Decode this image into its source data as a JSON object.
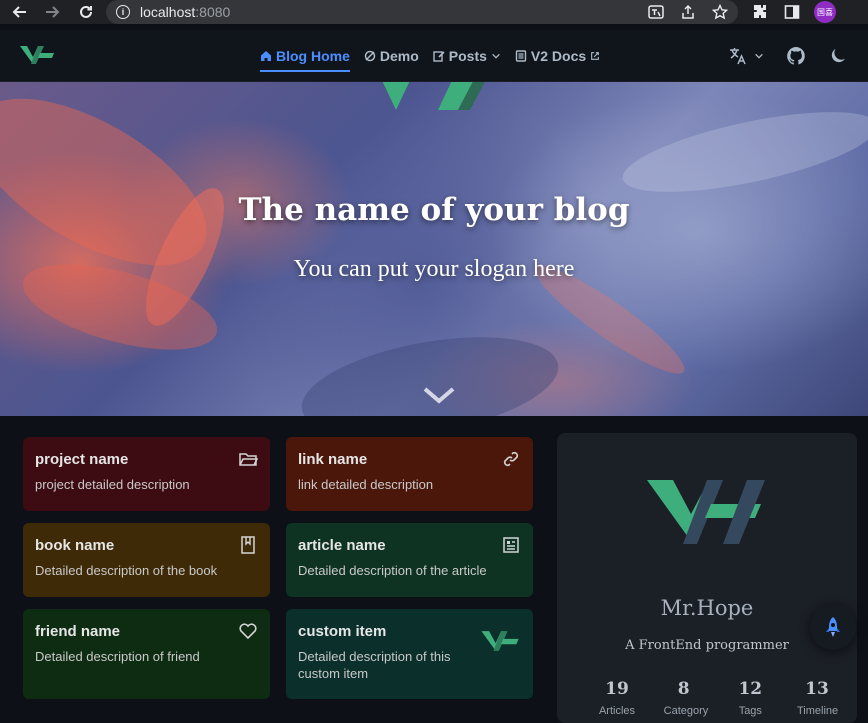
{
  "browser": {
    "url_host": "localhost",
    "url_port": ":8080",
    "profile_label": "国喜"
  },
  "navbar": {
    "items": [
      {
        "label": "Blog Home",
        "icon": "home-icon",
        "active": true
      },
      {
        "label": "Demo",
        "icon": "demo-icon",
        "active": false
      },
      {
        "label": "Posts",
        "icon": "edit-icon",
        "active": false
      },
      {
        "label": "V2 Docs",
        "icon": "docs-icon",
        "active": false
      }
    ]
  },
  "hero": {
    "title": "The name of your blog",
    "slogan": "You can put your slogan here"
  },
  "projects": [
    {
      "title": "project name",
      "desc": "project detailed description",
      "icon": "folder-icon",
      "color": "#3d0b12"
    },
    {
      "title": "link name",
      "desc": "link detailed description",
      "icon": "link-icon",
      "color": "#4a170a"
    },
    {
      "title": "book name",
      "desc": "Detailed description of the book",
      "icon": "book-icon",
      "color": "#3f2a07"
    },
    {
      "title": "article name",
      "desc": "Detailed description of the article",
      "icon": "article-icon",
      "color": "#0f3322"
    },
    {
      "title": "friend name",
      "desc": "Detailed description of friend",
      "icon": "heart-icon",
      "color": "#0e2c12"
    },
    {
      "title": "custom item",
      "desc": "Detailed description of this custom item",
      "icon": "vh-logo-icon",
      "color": "#0b2f2a"
    }
  ],
  "profile": {
    "name": "Mr.Hope",
    "description": "A FrontEnd programmer",
    "stats": [
      {
        "num": "19",
        "label": "Articles"
      },
      {
        "num": "8",
        "label": "Category"
      },
      {
        "num": "12",
        "label": "Tags"
      },
      {
        "num": "13",
        "label": "Timeline"
      }
    ]
  },
  "colors": {
    "accent": "#4a8eff",
    "brand": "#3eaf7c"
  }
}
